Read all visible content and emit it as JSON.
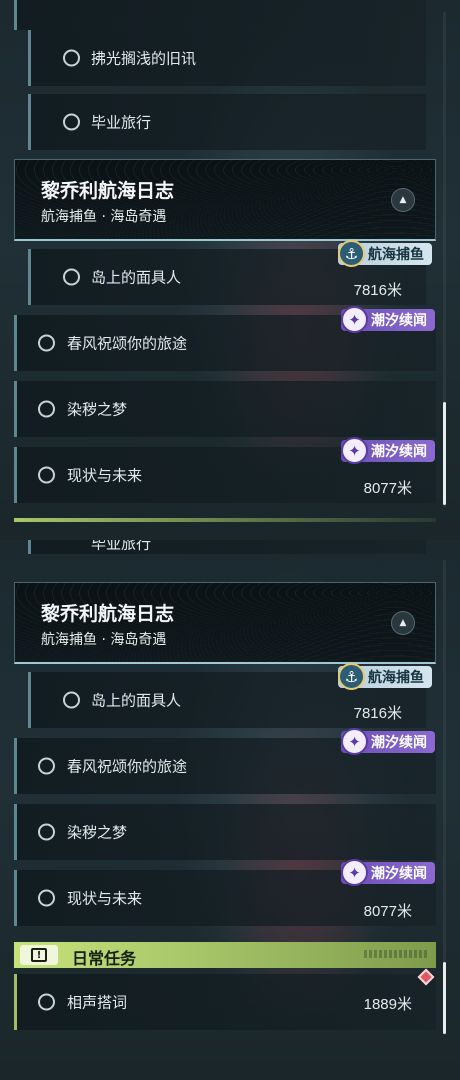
{
  "top_view": {
    "quests_above": [
      {
        "name": "拂光搁浅的旧讯"
      },
      {
        "name": "毕业旅行"
      }
    ],
    "chapter": {
      "title": "黎乔利航海日志",
      "subtitle": "航海捕鱼 · 海岛奇遇",
      "collapse_icon": "chevron-up-icon"
    },
    "quests": [
      {
        "name": "岛上的面具人",
        "distance": "7816米",
        "badge": "航海捕鱼"
      },
      {
        "name": "春风祝颂你的旅途",
        "badge": "潮汐续闻"
      },
      {
        "name": "染秽之梦"
      },
      {
        "name": "现状与未来",
        "distance": "8077米",
        "badge": "潮汐续闻"
      }
    ]
  },
  "bottom_view": {
    "partial_quest": {
      "name": "毕业旅行"
    },
    "chapter": {
      "title": "黎乔利航海日志",
      "subtitle": "航海捕鱼 · 海岛奇遇",
      "collapse_icon": "chevron-up-icon"
    },
    "quests": [
      {
        "name": "岛上的面具人",
        "distance": "7816米",
        "badge": "航海捕鱼"
      },
      {
        "name": "春风祝颂你的旅途",
        "badge": "潮汐续闻"
      },
      {
        "name": "染秽之梦"
      },
      {
        "name": "现状与未来",
        "distance": "8077米",
        "badge": "潮汐续闻"
      }
    ],
    "daily_section": {
      "title": "日常任务",
      "icon": "exclamation-icon",
      "quests": [
        {
          "name": "相声搭词",
          "distance": "1889米",
          "tracked": true
        }
      ]
    }
  },
  "colors": {
    "badge_fishing": "#b8cfdc",
    "badge_tide": "#7a5cc4",
    "daily_accent": "#c8e27a",
    "tracked_marker": "#e05a66"
  }
}
